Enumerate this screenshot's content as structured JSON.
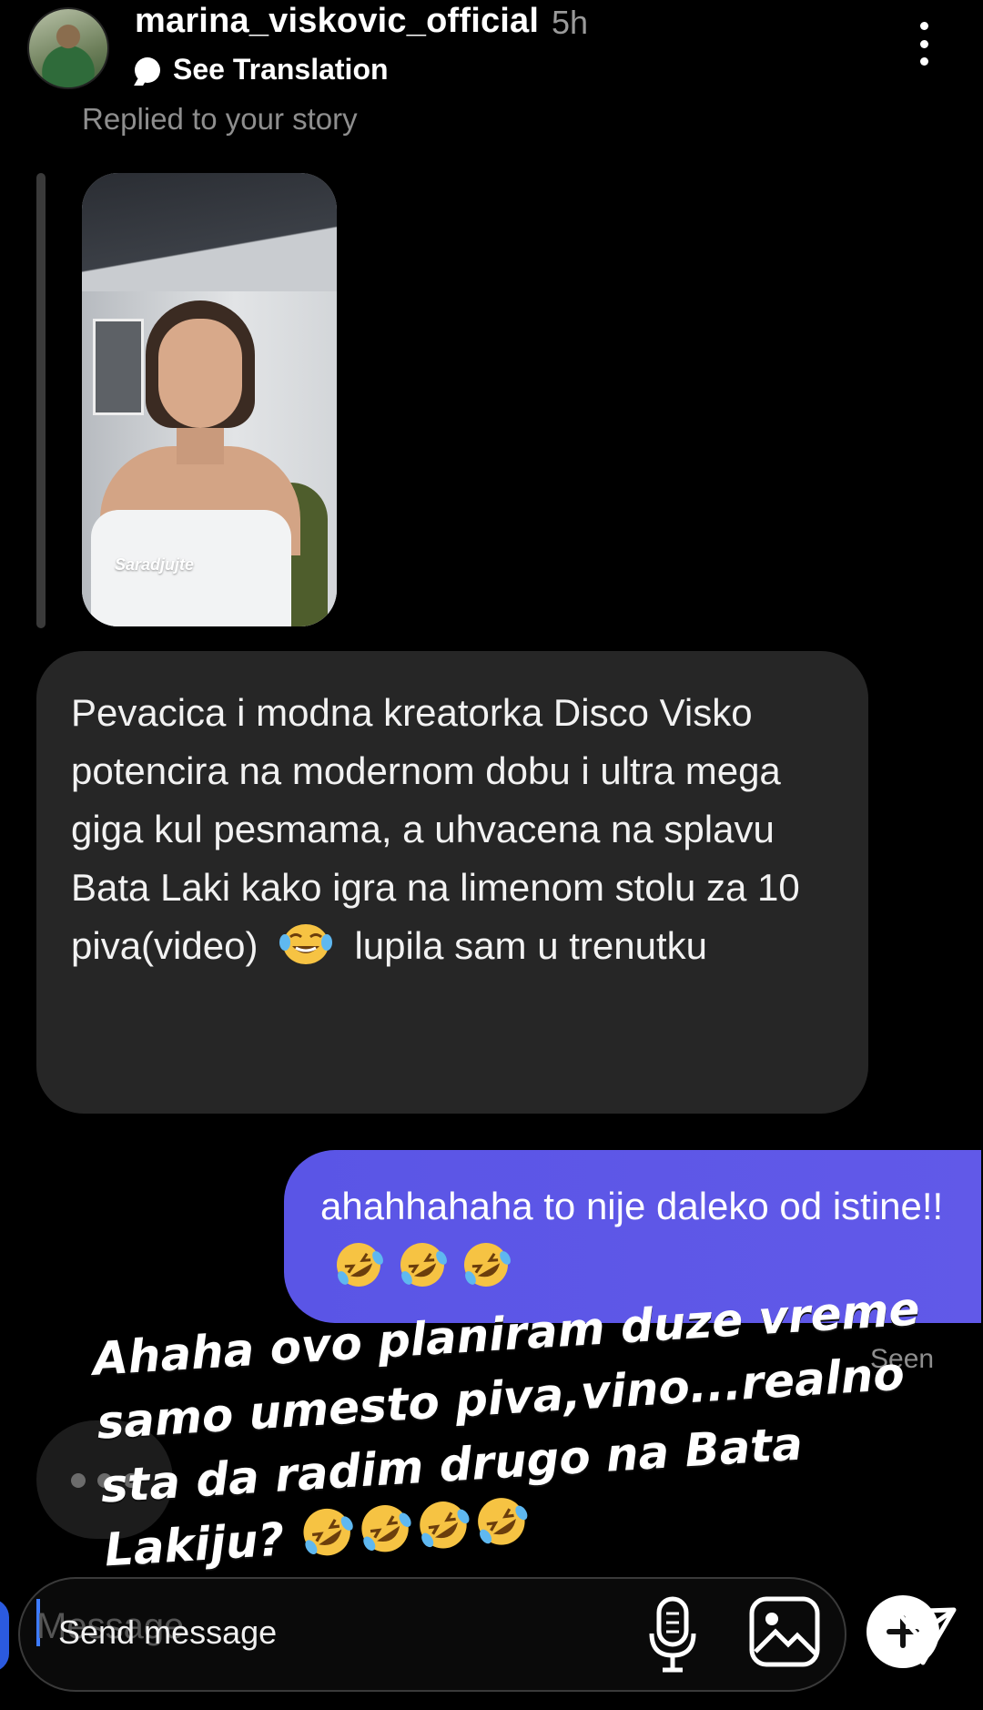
{
  "header": {
    "username": "marina_viskovic_official",
    "time": "5h",
    "translate_label": "See Translation",
    "replied_label": "Replied to your story"
  },
  "story": {
    "caption": "Saradjujte"
  },
  "messages": {
    "incoming": {
      "text_before_emoji": "Pevacica i modna kreatorka Disco Visko potencira na modernom dobu i ultra mega giga kul pesmama, a uhvacena na splavu Bata Laki kako igra na limenom stolu za 10 piva(video)",
      "emoji": "face-with-tears-of-joy",
      "text_after_emoji": "lupila sam u trenutku"
    },
    "outgoing": {
      "text": "ahahhahaha to nije daleko od istine!!",
      "emoji": "rolling-on-the-floor-laughing",
      "emoji_count": 3,
      "status": "Seen"
    }
  },
  "overlay_text": {
    "text": "Ahaha ovo planiram duze vreme samo umesto piva,vino...realno sta da radim drugo na Bata Lakiju?",
    "emoji": "rolling-on-the-floor-laughing",
    "emoji_count": 4
  },
  "composer": {
    "placeholder": "Send message",
    "ghost_text": "Message"
  },
  "colors": {
    "background": "#000000",
    "incoming_bubble": "#262626",
    "outgoing_bubble": "#5a55e6",
    "muted_text": "#8e8e8e"
  }
}
